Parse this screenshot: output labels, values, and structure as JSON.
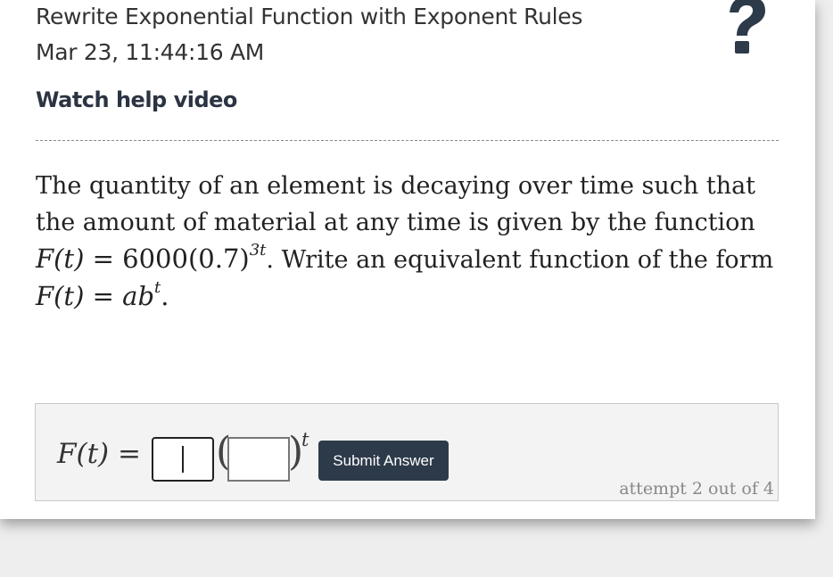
{
  "header": {
    "title": "Rewrite Exponential Function with Exponent Rules",
    "timestamp": "Mar 23, 11:44:16 AM",
    "help_link": "Watch help video",
    "help_icon": "question-mark-icon"
  },
  "question": {
    "text_1": "The quantity of an element is decaying over time such that the amount of material at any time is given by the function",
    "func_left": "F(t)",
    "equals": "=",
    "func_base": "6000(0.7)",
    "func_exp": "3t",
    "text_2": ". Write an equivalent function of the form",
    "form_left": "F(t)",
    "form_right": "ab",
    "form_exp": "t",
    "end": "."
  },
  "answer": {
    "label": "F(t) =",
    "input_a_value": "",
    "input_b_value": "",
    "open_paren": "(",
    "close_paren": ")",
    "exponent": "t",
    "submit_label": "Submit Answer",
    "attempt_text": "attempt 2 out of 4"
  }
}
